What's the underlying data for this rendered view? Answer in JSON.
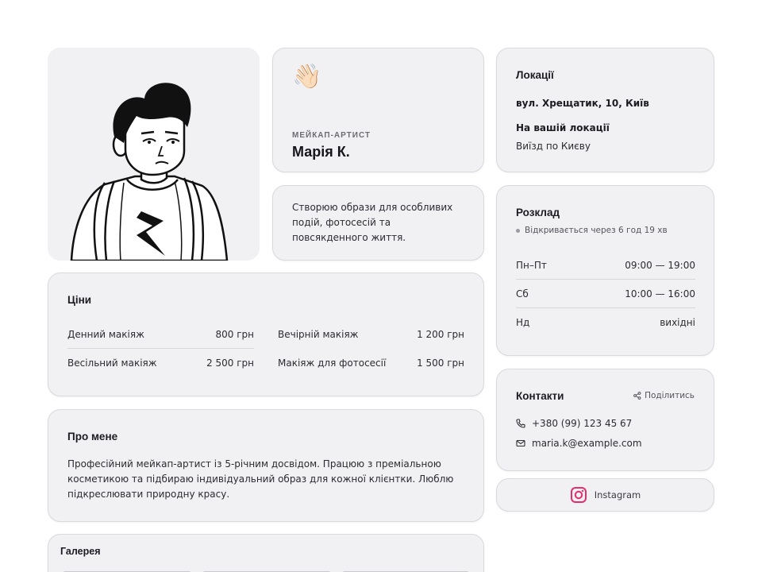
{
  "profile": {
    "wave_emoji": "👋🏻",
    "role": "МЕЙКАП-АРТИСТ",
    "name": "Марія К.",
    "bio": "Створюю образи для особливих подій, фотосесій та повсякденного життя."
  },
  "prices": {
    "title": "Ціни",
    "items": [
      {
        "label": "Денний макіяж",
        "price": "800 грн"
      },
      {
        "label": "Вечірній макіяж",
        "price": "1 200 грн"
      },
      {
        "label": "Весільний макіяж",
        "price": "2 500 грн"
      },
      {
        "label": "Макіяж для фотосесії",
        "price": "1 500 грн"
      }
    ]
  },
  "about": {
    "title": "Про мене",
    "text": "Професійний мейкап-артист із 5-річним досвідом. Працюю з преміальною косметикою та підбираю індивідуальний образ для кожної клієнтки. Люблю підкреслювати природну красу."
  },
  "gallery": {
    "title": "Галерея"
  },
  "locations": {
    "title": "Локації",
    "address": "вул. Хрещатик, 10, Київ",
    "on_site_label": "На вашій локації",
    "on_site_note": "Виїзд по Києву"
  },
  "schedule": {
    "title": "Розклад",
    "status": "Відкривається через 6 год 19 хв",
    "rows": [
      {
        "day": "Пн–Пт",
        "hours": "09:00 — 19:00"
      },
      {
        "day": "Сб",
        "hours": "10:00 — 16:00"
      },
      {
        "day": "Нд",
        "hours": "вихідні"
      }
    ]
  },
  "contacts": {
    "title": "Контакти",
    "share_label": "Поділитись",
    "phone": "+380 (99) 123 45 67",
    "email": "maria.k@example.com"
  },
  "social": {
    "instagram_label": "Instagram",
    "instagram_color": "#e1306c"
  },
  "colors": {
    "card_bg": "#f1f1f4",
    "card_border": "#d9d9de",
    "text": "#1c1c22"
  },
  "icons": {
    "phone": "phone-icon",
    "email": "mail-icon",
    "share": "share-icon",
    "instagram": "instagram-icon"
  }
}
